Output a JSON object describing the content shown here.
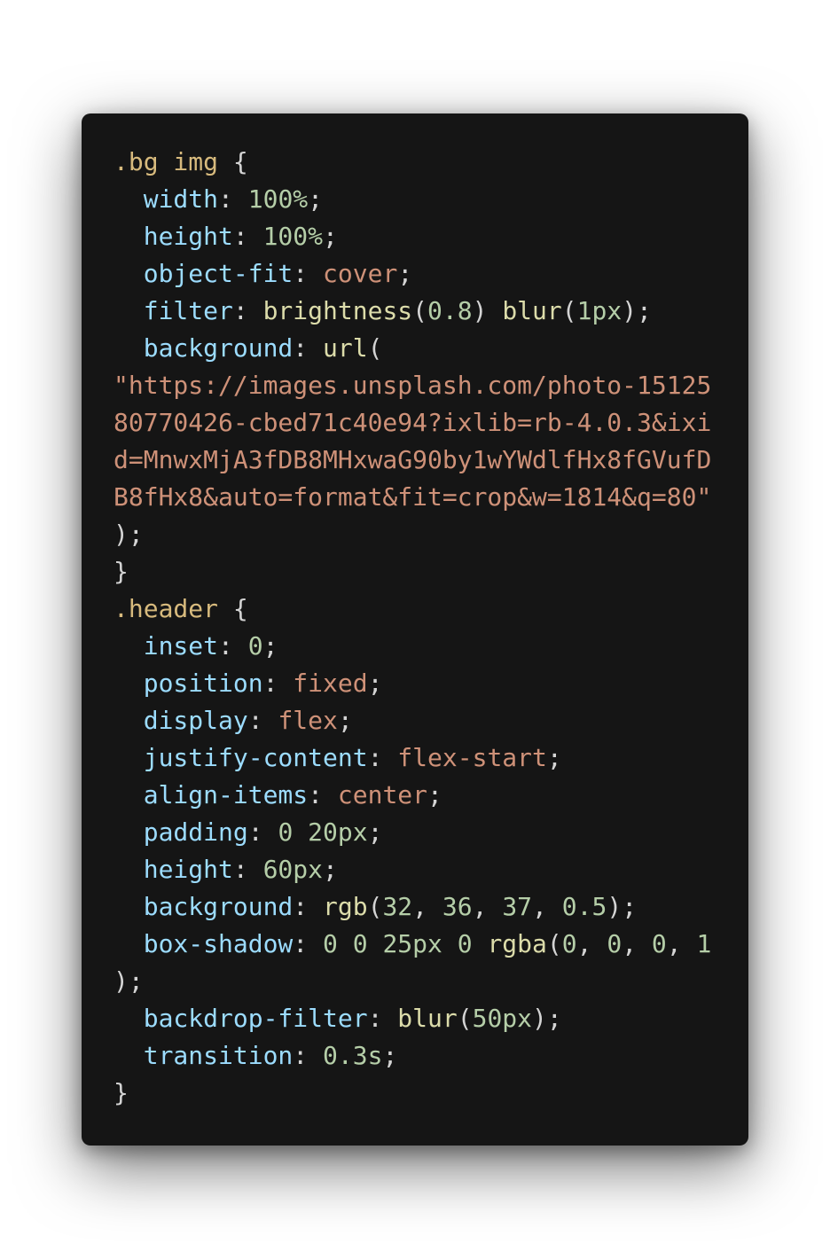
{
  "theme": {
    "card_background": "#151515",
    "page_background": "#ffffff",
    "colors": {
      "sel": "#d7ba7d",
      "prop": "#9cdcfe",
      "num": "#b5cea8",
      "str": "#ce9178",
      "fn": "#dcdcaa",
      "punc": "#d4d4d4"
    }
  },
  "code": {
    "language": "css",
    "lines": [
      [
        {
          "t": "sel",
          "v": ".bg img "
        },
        {
          "t": "punc",
          "v": "{"
        }
      ],
      [
        {
          "t": "prop",
          "v": "  width"
        },
        {
          "t": "punc",
          "v": ": "
        },
        {
          "t": "num",
          "v": "100%"
        },
        {
          "t": "punc",
          "v": ";"
        }
      ],
      [
        {
          "t": "prop",
          "v": "  height"
        },
        {
          "t": "punc",
          "v": ": "
        },
        {
          "t": "num",
          "v": "100%"
        },
        {
          "t": "punc",
          "v": ";"
        }
      ],
      [
        {
          "t": "prop",
          "v": "  object-fit"
        },
        {
          "t": "punc",
          "v": ": "
        },
        {
          "t": "str",
          "v": "cover"
        },
        {
          "t": "punc",
          "v": ";"
        }
      ],
      [
        {
          "t": "prop",
          "v": "  filter"
        },
        {
          "t": "punc",
          "v": ": "
        },
        {
          "t": "fn",
          "v": "brightness"
        },
        {
          "t": "punc",
          "v": "("
        },
        {
          "t": "num",
          "v": "0.8"
        },
        {
          "t": "punc",
          "v": ") "
        },
        {
          "t": "fn",
          "v": "blur"
        },
        {
          "t": "punc",
          "v": "("
        },
        {
          "t": "num",
          "v": "1px"
        },
        {
          "t": "punc",
          "v": ");"
        }
      ],
      [
        {
          "t": "prop",
          "v": "  background"
        },
        {
          "t": "punc",
          "v": ": "
        },
        {
          "t": "fn",
          "v": "url"
        },
        {
          "t": "punc",
          "v": "("
        }
      ],
      [
        {
          "t": "str",
          "v": "\"https://images.unsplash.com/photo-15125"
        }
      ],
      [
        {
          "t": "str",
          "v": "80770426-cbed71c40e94?ixlib=rb-4.0.3&ixi"
        }
      ],
      [
        {
          "t": "str",
          "v": "d=MnwxMjA3fDB8MHxwaG90by1wYWdlfHx8fGVufD"
        }
      ],
      [
        {
          "t": "str",
          "v": "B8fHx8&auto=format&fit=crop&w=1814&q=80\""
        }
      ],
      [
        {
          "t": "punc",
          "v": ");"
        }
      ],
      [
        {
          "t": "punc",
          "v": "}"
        }
      ],
      [
        {
          "t": "sel",
          "v": ".header "
        },
        {
          "t": "punc",
          "v": "{"
        }
      ],
      [
        {
          "t": "prop",
          "v": "  inset"
        },
        {
          "t": "punc",
          "v": ": "
        },
        {
          "t": "num",
          "v": "0"
        },
        {
          "t": "punc",
          "v": ";"
        }
      ],
      [
        {
          "t": "prop",
          "v": "  position"
        },
        {
          "t": "punc",
          "v": ": "
        },
        {
          "t": "str",
          "v": "fixed"
        },
        {
          "t": "punc",
          "v": ";"
        }
      ],
      [
        {
          "t": "prop",
          "v": "  display"
        },
        {
          "t": "punc",
          "v": ": "
        },
        {
          "t": "str",
          "v": "flex"
        },
        {
          "t": "punc",
          "v": ";"
        }
      ],
      [
        {
          "t": "prop",
          "v": "  justify-content"
        },
        {
          "t": "punc",
          "v": ": "
        },
        {
          "t": "str",
          "v": "flex-start"
        },
        {
          "t": "punc",
          "v": ";"
        }
      ],
      [
        {
          "t": "prop",
          "v": "  align-items"
        },
        {
          "t": "punc",
          "v": ": "
        },
        {
          "t": "str",
          "v": "center"
        },
        {
          "t": "punc",
          "v": ";"
        }
      ],
      [
        {
          "t": "prop",
          "v": "  padding"
        },
        {
          "t": "punc",
          "v": ": "
        },
        {
          "t": "num",
          "v": "0 20px"
        },
        {
          "t": "punc",
          "v": ";"
        }
      ],
      [
        {
          "t": "prop",
          "v": "  height"
        },
        {
          "t": "punc",
          "v": ": "
        },
        {
          "t": "num",
          "v": "60px"
        },
        {
          "t": "punc",
          "v": ";"
        }
      ],
      [
        {
          "t": "prop",
          "v": "  background"
        },
        {
          "t": "punc",
          "v": ": "
        },
        {
          "t": "fn",
          "v": "rgb"
        },
        {
          "t": "punc",
          "v": "("
        },
        {
          "t": "num",
          "v": "32"
        },
        {
          "t": "punc",
          "v": ", "
        },
        {
          "t": "num",
          "v": "36"
        },
        {
          "t": "punc",
          "v": ", "
        },
        {
          "t": "num",
          "v": "37"
        },
        {
          "t": "punc",
          "v": ", "
        },
        {
          "t": "num",
          "v": "0.5"
        },
        {
          "t": "punc",
          "v": ");"
        }
      ],
      [
        {
          "t": "prop",
          "v": "  box-shadow"
        },
        {
          "t": "punc",
          "v": ": "
        },
        {
          "t": "num",
          "v": "0 0 25px 0 "
        },
        {
          "t": "fn",
          "v": "rgba"
        },
        {
          "t": "punc",
          "v": "("
        },
        {
          "t": "num",
          "v": "0"
        },
        {
          "t": "punc",
          "v": ", "
        },
        {
          "t": "num",
          "v": "0"
        },
        {
          "t": "punc",
          "v": ", "
        },
        {
          "t": "num",
          "v": "0"
        },
        {
          "t": "punc",
          "v": ", "
        },
        {
          "t": "num",
          "v": "1"
        }
      ],
      [
        {
          "t": "punc",
          "v": ");"
        }
      ],
      [
        {
          "t": "prop",
          "v": "  backdrop-filter"
        },
        {
          "t": "punc",
          "v": ": "
        },
        {
          "t": "fn",
          "v": "blur"
        },
        {
          "t": "punc",
          "v": "("
        },
        {
          "t": "num",
          "v": "50px"
        },
        {
          "t": "punc",
          "v": ");"
        }
      ],
      [
        {
          "t": "prop",
          "v": "  transition"
        },
        {
          "t": "punc",
          "v": ": "
        },
        {
          "t": "num",
          "v": "0.3s"
        },
        {
          "t": "punc",
          "v": ";"
        }
      ],
      [
        {
          "t": "punc",
          "v": "}"
        }
      ]
    ]
  }
}
